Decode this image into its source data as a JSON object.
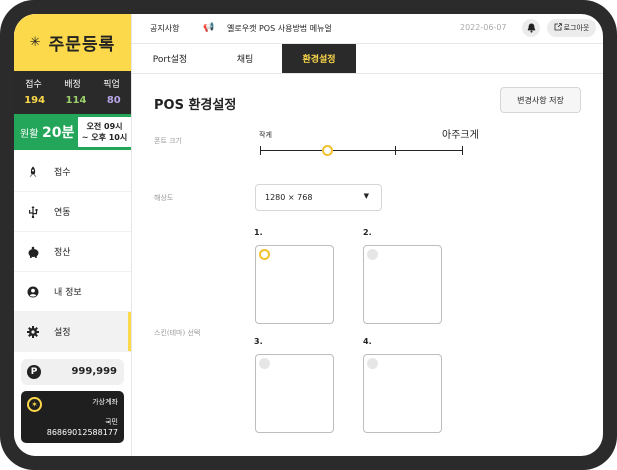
{
  "sidebar": {
    "brand": {
      "icon": "sparkle-icon",
      "title": "주문등록"
    },
    "stats": {
      "labels": [
        "접수",
        "배정",
        "픽업"
      ],
      "values": [
        "194",
        "114",
        "80"
      ],
      "colors": [
        "#fcd94a",
        "#9ad06a",
        "#b6a4e6"
      ]
    },
    "wait": {
      "label": "원활",
      "time": "20분",
      "hours_open": "오전 09시",
      "hours_close": "~ 오후 10시"
    },
    "menu": [
      {
        "label": "접수",
        "icon": "rocket-icon"
      },
      {
        "label": "연동",
        "icon": "usb-icon"
      },
      {
        "label": "정산",
        "icon": "piggy-bank-icon"
      },
      {
        "label": "내 정보",
        "icon": "user-icon"
      },
      {
        "label": "설정",
        "icon": "gear-icon",
        "active": true
      }
    ],
    "points": {
      "badge": "P",
      "value": "999,999"
    },
    "account": {
      "label": "가상계좌",
      "bank": "국민",
      "number": "86869012588177"
    }
  },
  "topbar": {
    "notice_label": "공지사항",
    "notice_icon": "megaphone-icon",
    "notice_text": "옐로우캣 POS 사용방법 메뉴얼",
    "date": "2022-06-07",
    "bell_icon": "bell-icon",
    "logout_label": "로그아웃"
  },
  "tabs": [
    {
      "label": "Port설정"
    },
    {
      "label": "채팅"
    },
    {
      "label": "환경설정",
      "active": true
    }
  ],
  "main": {
    "title": "POS 환경설정",
    "save_label": "변경사항 저장",
    "font_size": {
      "label": "폰트 크기",
      "min_label": "작게",
      "max_label": "아주크게",
      "level": 0.33,
      "steps": 4
    },
    "resolution": {
      "label": "해상도",
      "value": "1280 × 768"
    },
    "skin": {
      "label": "스킨(테마) 선택",
      "options": [
        {
          "number": "1.",
          "selected": true
        },
        {
          "number": "2.",
          "selected": false
        },
        {
          "number": "3.",
          "selected": false
        },
        {
          "number": "4.",
          "selected": false
        }
      ]
    }
  }
}
